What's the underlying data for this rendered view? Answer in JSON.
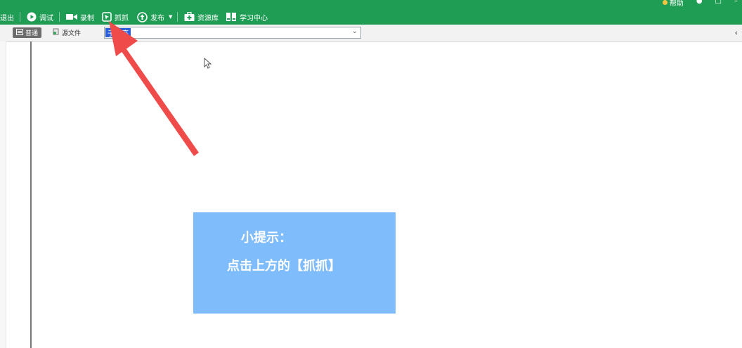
{
  "toolbar": {
    "items": [
      {
        "label": "退出",
        "icon": "exit-icon"
      },
      {
        "label": "调试",
        "icon": "play-icon"
      },
      {
        "label": "录制",
        "icon": "camera-icon"
      },
      {
        "label": "抓抓",
        "icon": "capture-icon"
      },
      {
        "label": "发布",
        "icon": "upload-icon"
      },
      {
        "label": "资源库",
        "icon": "resource-icon"
      },
      {
        "label": "学习中心",
        "icon": "book-icon"
      }
    ],
    "right_label": "帮助"
  },
  "tabs": [
    {
      "label": "普通",
      "active": true
    },
    {
      "label": "源文件",
      "active": false
    }
  ],
  "combo": {
    "value": "子程序"
  },
  "hint": {
    "line1": "小提示：",
    "line2": "点击上方的【抓抓】"
  },
  "colors": {
    "toolbar_bg": "#1f9d55",
    "hint_bg": "#7fbcfb",
    "arrow": "#f04b4b"
  }
}
